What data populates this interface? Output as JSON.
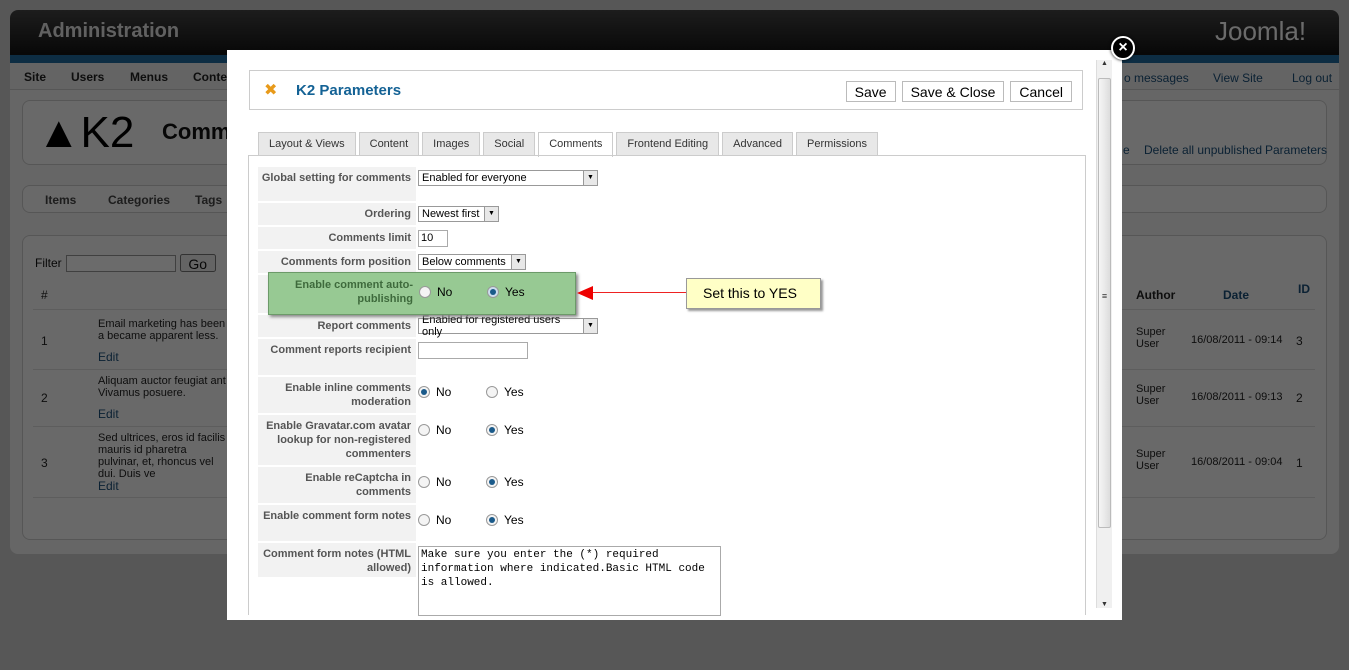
{
  "background": {
    "title": "Administration",
    "logo": "Joomla!",
    "menu": [
      "Site",
      "Users",
      "Menus",
      "Conte"
    ],
    "status": [
      "o messages",
      "View Site",
      "Log out"
    ],
    "component": "Comm",
    "toolbar": [
      "e",
      "Delete all unpublished",
      "Parameters"
    ],
    "submenu": [
      "Items",
      "Categories",
      "Tags"
    ],
    "filter_label": "Filter",
    "go": "Go",
    "columns": {
      "num": "#",
      "author": "Author",
      "date": "Date",
      "id": "ID"
    },
    "rows": [
      {
        "n": "1",
        "text": "Email marketing has been a became apparent less.",
        "edit": "Edit",
        "author": "Super User",
        "date": "16/08/2011 - 09:14",
        "id": "3"
      },
      {
        "n": "2",
        "text": "Aliquam auctor feugiat ant Vivamus posuere.",
        "edit": "Edit",
        "author": "Super User",
        "date": "16/08/2011 - 09:13",
        "id": "2"
      },
      {
        "n": "3",
        "text": "Sed ultrices, eros id facilis mauris id pharetra pulvinar, et, rhoncus vel dui. Duis ve",
        "edit": "Edit",
        "author": "Super User",
        "date": "16/08/2011 - 09:04",
        "id": "1"
      }
    ]
  },
  "modal": {
    "title": "K2 Parameters",
    "buttons": {
      "save": "Save",
      "save_close": "Save & Close",
      "cancel": "Cancel"
    },
    "tabs": [
      "Layout & Views",
      "Content",
      "Images",
      "Social",
      "Comments",
      "Frontend Editing",
      "Advanced",
      "Permissions"
    ],
    "active_tab": "Comments",
    "fields": {
      "global": {
        "label": "Global setting for comments",
        "value": "Enabled for everyone"
      },
      "ordering": {
        "label": "Ordering",
        "value": "Newest first"
      },
      "limit": {
        "label": "Comments limit",
        "value": "10"
      },
      "position": {
        "label": "Comments form position",
        "value": "Below comments"
      },
      "autopub": {
        "label": "Enable comment auto-publishing",
        "selected": "Yes"
      },
      "report": {
        "label": "Report comments",
        "value": "Enabled for registered users only"
      },
      "recipient": {
        "label": "Comment reports recipient",
        "value": ""
      },
      "inline": {
        "label": "Enable inline comments moderation",
        "selected": "No"
      },
      "gravatar": {
        "label": "Enable Gravatar.com avatar lookup for non-registered commenters",
        "selected": "Yes"
      },
      "recaptcha": {
        "label": "Enable reCaptcha in comments",
        "selected": "Yes"
      },
      "notes": {
        "label": "Enable comment form notes",
        "selected": "Yes"
      },
      "notes_text": {
        "label": "Comment form notes (HTML allowed)",
        "value": "Make sure you enter the (*) required information where indicated.Basic HTML code is allowed."
      }
    },
    "no": "No",
    "yes": "Yes"
  },
  "callout": "Set this to YES"
}
